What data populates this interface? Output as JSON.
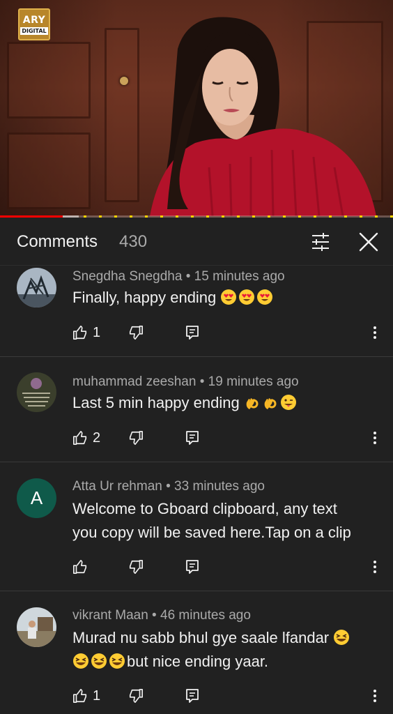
{
  "video": {
    "channel_logo_top": "ARY",
    "channel_logo_bottom": "DIGITAL",
    "progress_fraction": 0.16,
    "buffer_fraction": 0.04
  },
  "header": {
    "title": "Comments",
    "count": "430",
    "filter_icon": "tune-icon",
    "close_icon": "close-icon"
  },
  "comments": [
    {
      "author": "Snegdha Snegdha",
      "time": "15 minutes ago",
      "text": "Finally, happy ending",
      "emojis": [
        "heart-eyes",
        "heart-eyes",
        "heart-eyes"
      ],
      "likes": "1",
      "avatar": "photo-tree"
    },
    {
      "author": "muhammad zeeshan",
      "time": "19 minutes ago",
      "text": "Last 5 min happy ending",
      "emojis": [
        "ok-hand",
        "ok-hand",
        "winking-tongue"
      ],
      "likes": "2",
      "avatar": "photo-calligraphy"
    },
    {
      "author": "Atta Ur rehman",
      "time": "33 minutes ago",
      "text_line1": "Welcome to Gboard clipboard, any text",
      "text_line2": "you copy will be saved here.Tap on a clip",
      "likes": "",
      "avatar_letter": "A",
      "avatar_color": "#0f5a4a"
    },
    {
      "author": "vikrant Maan",
      "time": "46 minutes ago",
      "text_line1": "Murad nu sabb bhul gye saale lfandar",
      "text_line2": "but nice ending yaar.",
      "emojis_line1": [
        "laughing"
      ],
      "emojis_line2": [
        "laughing",
        "laughing",
        "laughing"
      ],
      "likes": "1",
      "avatar": "photo-person"
    }
  ],
  "icons": {
    "like": "thumb-up-icon",
    "dislike": "thumb-down-icon",
    "reply": "reply-icon",
    "more": "more-vert-icon"
  },
  "colors": {
    "background": "#212121",
    "text_primary": "#f1f1f1",
    "text_secondary": "#aaaaaa",
    "progress_red": "#ff0000",
    "ad_marker_yellow": "#ffd400"
  }
}
